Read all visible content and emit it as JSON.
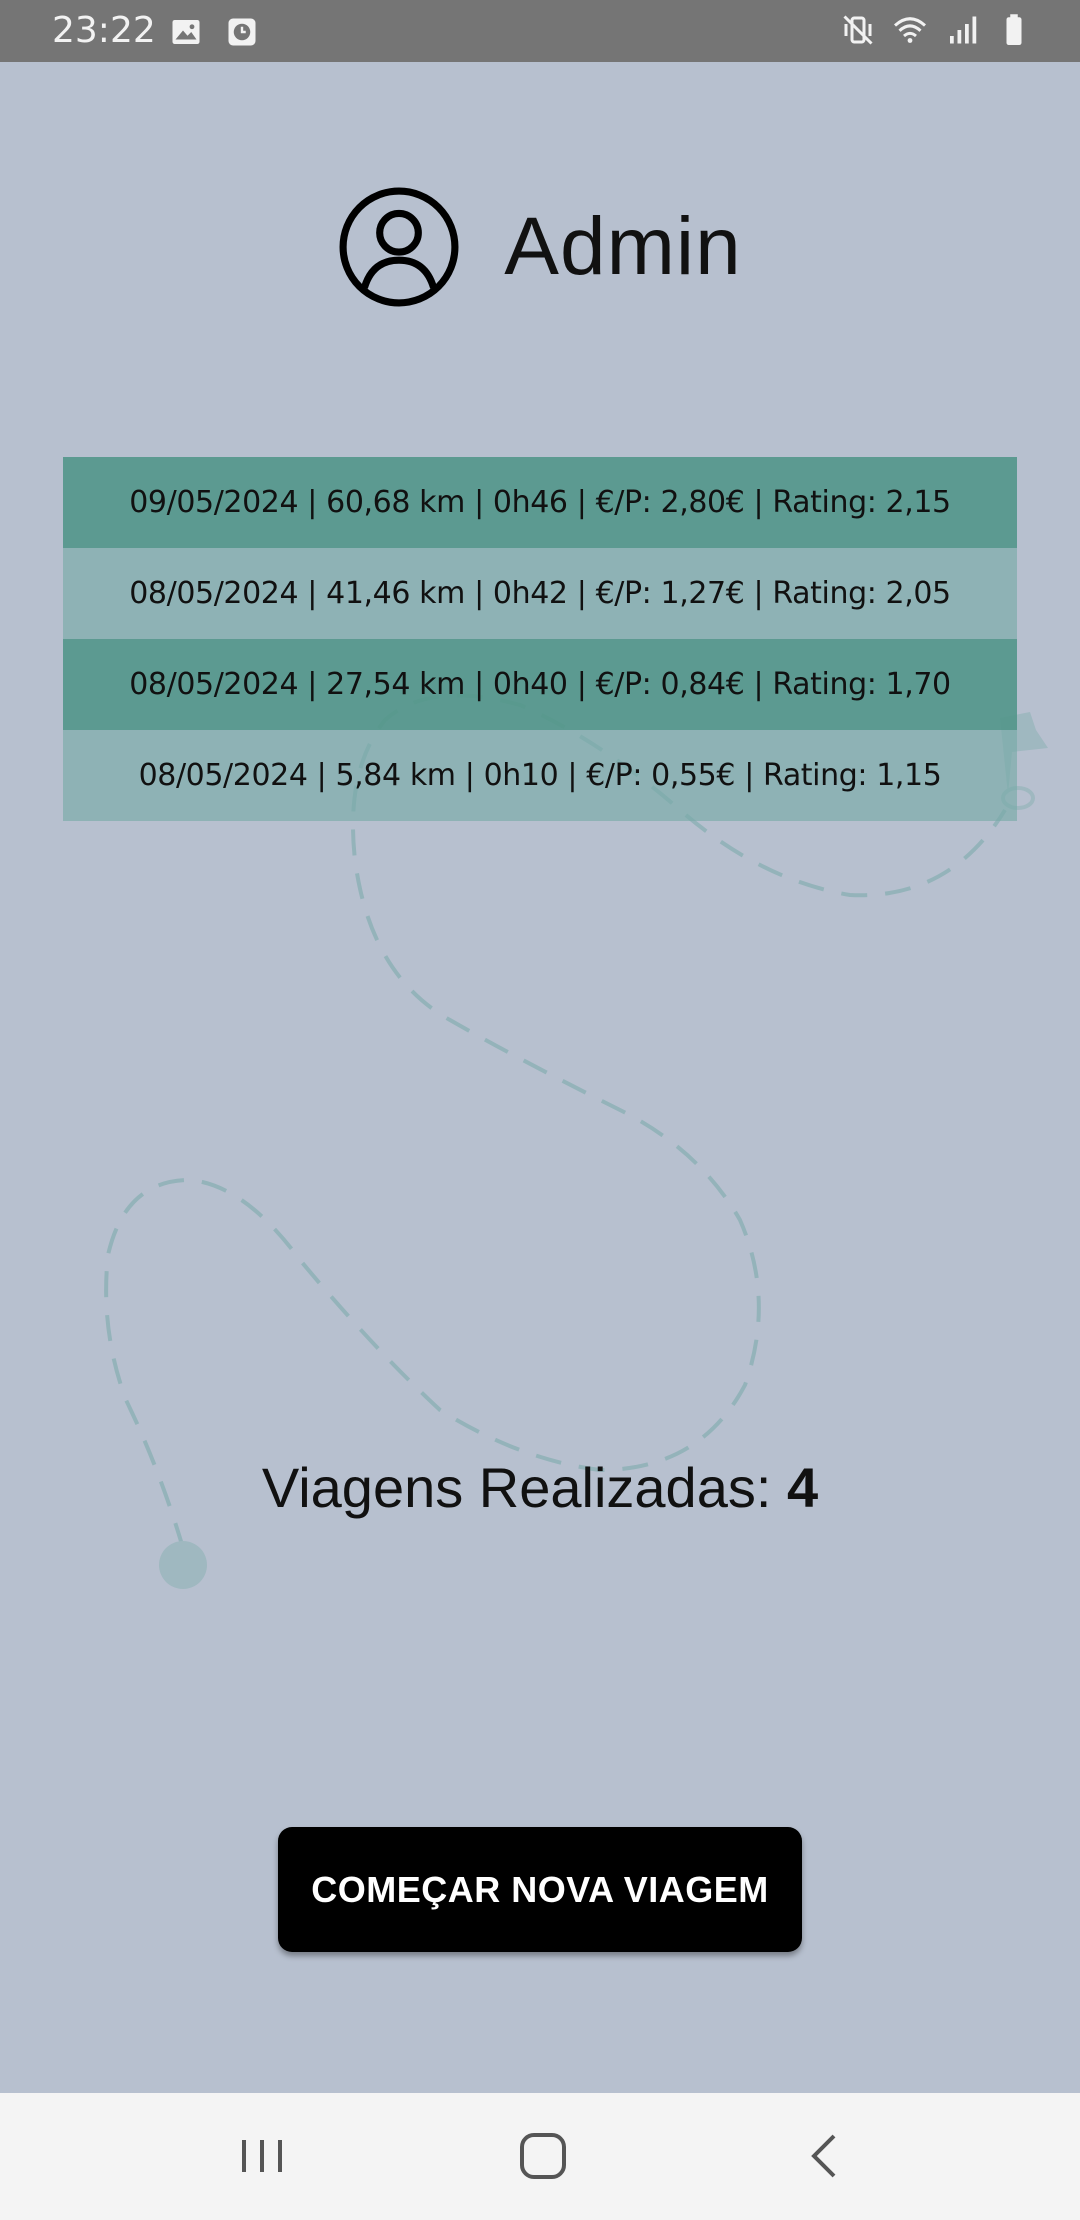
{
  "status_bar": {
    "time": "23:22",
    "left_icons": [
      "image-icon",
      "clock-notification-icon"
    ],
    "right_icons": [
      "vibrate-mute-icon",
      "wifi-icon",
      "signal-icon",
      "battery-icon"
    ]
  },
  "header": {
    "avatar_icon": "user-circle-icon",
    "username": "Admin"
  },
  "trips": [
    {
      "text": "09/05/2024 | 60,68 km | 0h46 | €/P: 2,80€ | Rating: 2,15"
    },
    {
      "text": "08/05/2024 | 41,46 km | 0h42 | €/P: 1,27€ | Rating: 2,05"
    },
    {
      "text": "08/05/2024 | 27,54 km | 0h40 | €/P: 0,84€ | Rating: 1,70"
    },
    {
      "text": "08/05/2024 | 5,84 km | 0h10 | €/P: 0,55€ | Rating: 1,15"
    }
  ],
  "summary": {
    "label": "Viagens Realizadas: ",
    "count": "4"
  },
  "actions": {
    "new_trip_label": "COMEÇAR NOVA VIAGEM"
  },
  "nav_bar": {
    "icons": [
      "recent-apps-icon",
      "home-icon",
      "back-icon"
    ]
  },
  "colors": {
    "background": "#b7c0cf",
    "row_dark": "#52968a",
    "row_light": "#78aaa8",
    "button": "#000000"
  }
}
